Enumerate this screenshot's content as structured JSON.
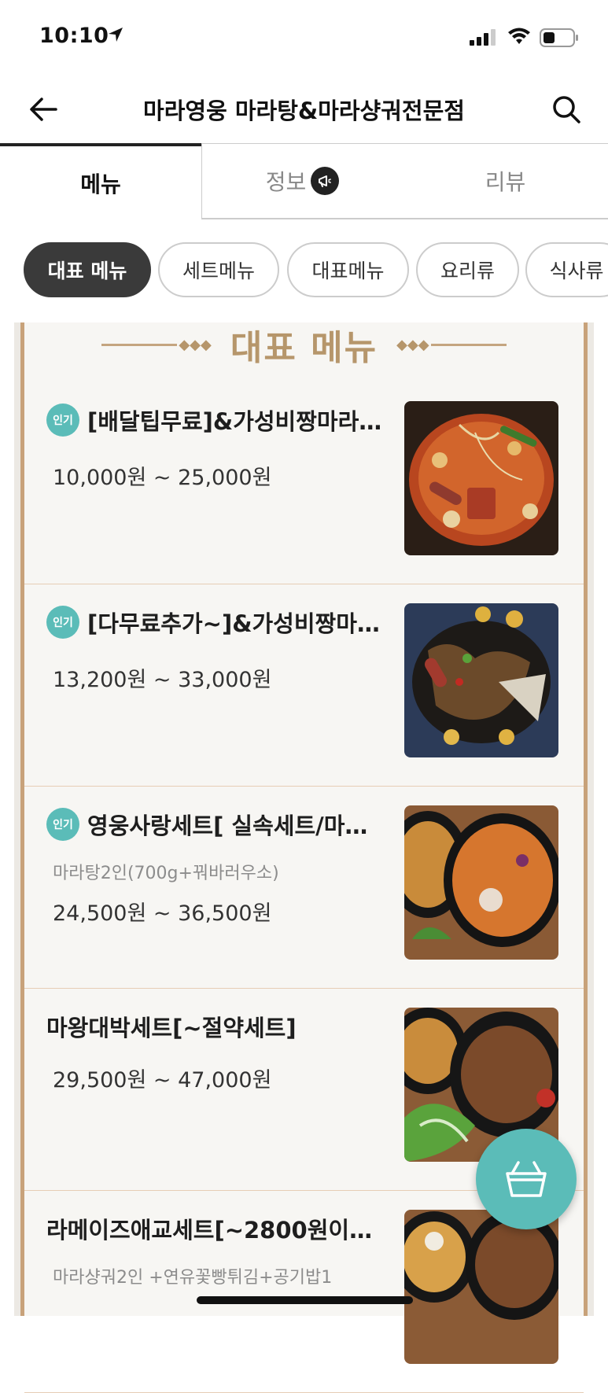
{
  "status_bar": {
    "time": "10:10"
  },
  "header": {
    "title": "마라영웅 마라탕&마라샹궈전문점"
  },
  "tabs": [
    {
      "label": "메뉴"
    },
    {
      "label": "정보"
    },
    {
      "label": "리뷰"
    }
  ],
  "chips": [
    {
      "label": "대표 메뉴"
    },
    {
      "label": "세트메뉴"
    },
    {
      "label": "대표메뉴"
    },
    {
      "label": "요리류"
    },
    {
      "label": "식사류"
    }
  ],
  "section": {
    "title": "대표 메뉴"
  },
  "popular_badge": "인기",
  "items": [
    {
      "name": "[배달팁무료]&가성비짱마라…",
      "price": "10,000원 ~ 25,000원"
    },
    {
      "name": "[다무료추가~]&가성비짱마…",
      "price": "13,200원 ~ 33,000원"
    },
    {
      "name": "영웅사랑세트[ 실속세트/마…",
      "desc": "마라탕2인(700g+꿔바러우소)",
      "price": "24,500원 ~ 36,500원"
    },
    {
      "name": "마왕대박세트[~절약세트]",
      "price": "29,500원 ~ 47,000원"
    },
    {
      "name": "라메이즈애교세트[~2800원이…",
      "desc": "마라샹궈2인 +연유꽃빵튀김+공기밥1"
    }
  ],
  "colors": {
    "accent": "#5bbcb8",
    "board_border": "#c8a27a",
    "section_title": "#b6966b",
    "active_chip": "#3a3a3a"
  }
}
